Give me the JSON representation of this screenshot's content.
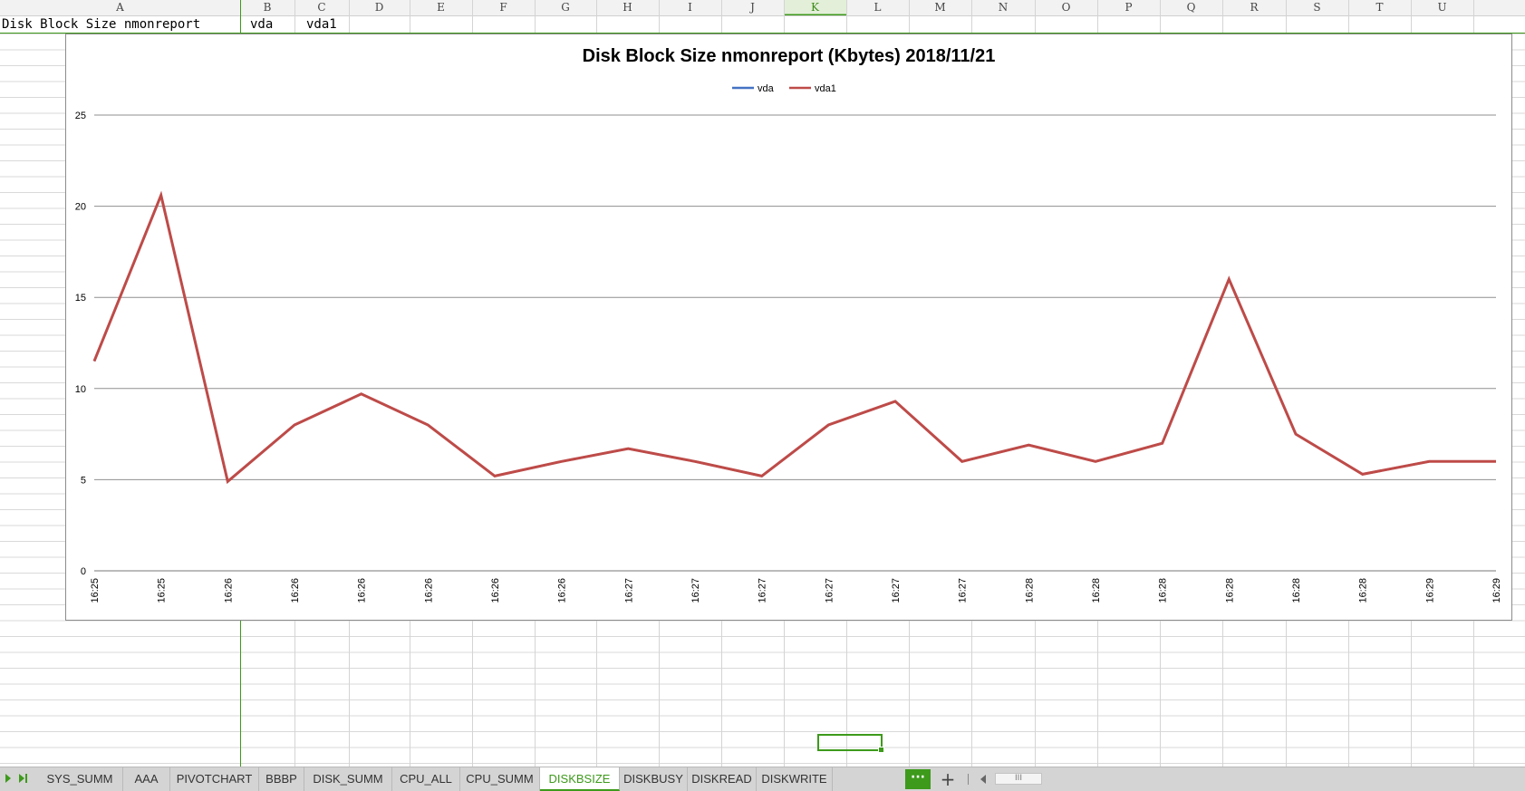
{
  "columns": [
    "A",
    "B",
    "C",
    "D",
    "E",
    "F",
    "G",
    "H",
    "I",
    "J",
    "K",
    "L",
    "M",
    "N",
    "O",
    "P",
    "Q",
    "R",
    "S",
    "T",
    "U"
  ],
  "selected_column": "K",
  "row1": {
    "A": "Disk Block Size nmonreport",
    "B": "vda",
    "C": "vda1"
  },
  "chart_data": {
    "type": "line",
    "title": "Disk Block Size nmonreport (Kbytes)  2018/11/21",
    "xlabel": "",
    "ylabel": "",
    "categories": [
      "16:25",
      "16:25",
      "16:26",
      "16:26",
      "16:26",
      "16:26",
      "16:26",
      "16:26",
      "16:27",
      "16:27",
      "16:27",
      "16:27",
      "16:27",
      "16:27",
      "16:28",
      "16:28",
      "16:28",
      "16:28",
      "16:28",
      "16:28",
      "16:29",
      "16:29"
    ],
    "series": [
      {
        "name": "vda",
        "color": "#4472c4",
        "values": [
          11.5,
          20.6,
          4.9,
          8.0,
          9.7,
          8.0,
          5.2,
          6.0,
          6.7,
          6.0,
          5.2,
          8.0,
          9.3,
          6.0,
          6.9,
          6.0,
          7.0,
          16.0,
          7.5,
          5.3,
          6.0,
          6.0
        ]
      },
      {
        "name": "vda1",
        "color": "#be4b48",
        "values": [
          11.5,
          20.6,
          4.9,
          8.0,
          9.7,
          8.0,
          5.2,
          6.0,
          6.7,
          6.0,
          5.2,
          8.0,
          9.3,
          6.0,
          6.9,
          6.0,
          7.0,
          16.0,
          7.5,
          5.3,
          6.0,
          6.0
        ]
      }
    ],
    "yticks": [
      0,
      5,
      10,
      15,
      20,
      25
    ],
    "ylim": [
      0,
      25
    ],
    "grid": true,
    "legend": "top"
  },
  "sheet_tabs": [
    "SYS_SUMM",
    "AAA",
    "PIVOTCHART",
    "BBBP",
    "DISK_SUMM",
    "CPU_ALL",
    "CPU_SUMM",
    "DISKBSIZE",
    "DISKBUSY",
    "DISKREAD",
    "DISKWRITE"
  ],
  "active_tab": "DISKBSIZE",
  "more_tabs_label": "···",
  "add_sheet_label": "+",
  "scroll_thumb_label": "III",
  "accent_color": "#3d9a1b"
}
